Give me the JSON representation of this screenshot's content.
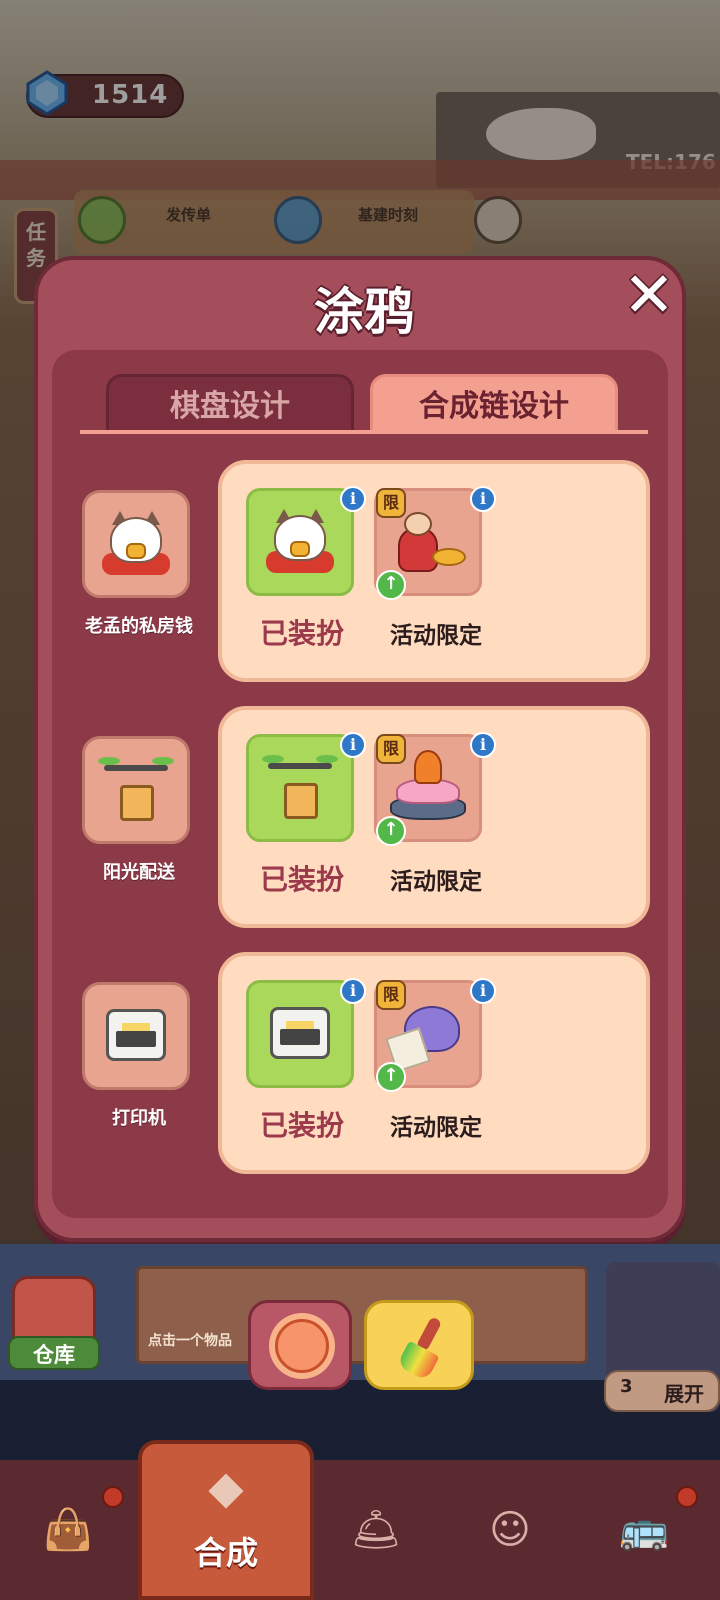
{
  "hud": {
    "gem_icon": "diamond-icon",
    "gem_count": "1514",
    "task_tab": "任务",
    "quests": [
      {
        "label": "发传单",
        "icon": "megaphone-icon"
      },
      {
        "label": "基建时刻",
        "icon": "paint-roller-icon"
      }
    ]
  },
  "modal": {
    "title": "涂鸦",
    "close_icon": "close-icon",
    "tabs": [
      {
        "label": "棋盘设计",
        "active": false
      },
      {
        "label": "合成链设计",
        "active": true
      }
    ],
    "rows": [
      {
        "source_name": "老孟的私房钱",
        "source_icon": "lucky-cat-icon",
        "equipped_label": "已装扮",
        "limited_badge": "限",
        "limited_icon": "god-of-wealth-icon",
        "limited_label": "活动限定"
      },
      {
        "source_name": "阳光配送",
        "source_icon": "delivery-drone-icon",
        "equipped_label": "已装扮",
        "limited_badge": "限",
        "limited_icon": "lotus-phoenix-icon",
        "limited_label": "活动限定"
      },
      {
        "source_name": "打印机",
        "source_icon": "printer-icon",
        "equipped_label": "已装扮",
        "limited_badge": "限",
        "limited_icon": "seashell-scroll-icon",
        "limited_label": "活动限定"
      }
    ]
  },
  "tray": {
    "store_label": "仓库",
    "hint": "点击一个物品",
    "expand_count": "3",
    "expand_label": "展开"
  },
  "nav": {
    "active_label": "合成",
    "items": [
      "bag-icon",
      "merge-icon",
      "service-bell-icon",
      "character-icon",
      "bus-icon"
    ]
  },
  "colors": {
    "modal_bg": "#a44e5c",
    "tab_active": "#f3a091",
    "panel_bg": "#ffdcc0",
    "equipped_slot": "#a9d85a",
    "info_blue": "#2f78c8"
  }
}
